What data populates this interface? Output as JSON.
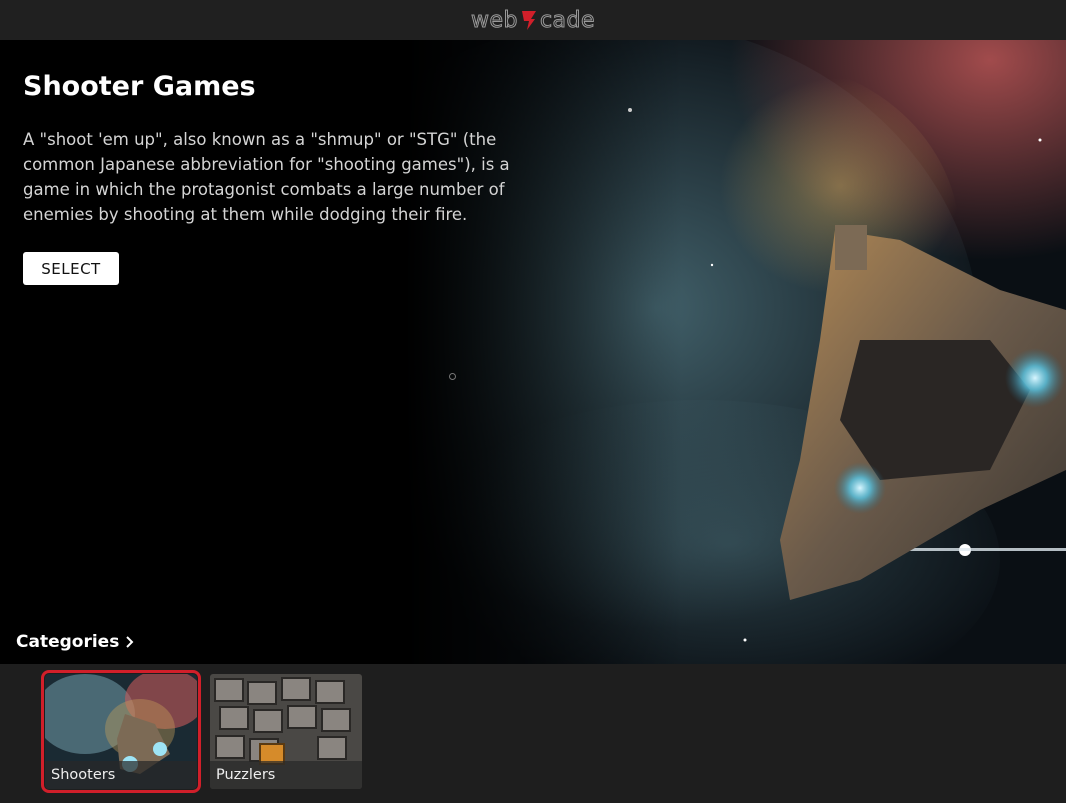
{
  "app": {
    "logo_text": "web cade"
  },
  "hero": {
    "title": "Shooter Games",
    "description": "A \"shoot 'em up\", also known as a \"shmup\" or \"STG\" (the common Japanese abbreviation for \"shooting games\"), is a game in which the protagonist combats a large number of enemies by shooting at them while dodging their fire.",
    "select_label": "SELECT"
  },
  "categories": {
    "header": "Categories",
    "items": [
      {
        "label": "Shooters",
        "selected": true
      },
      {
        "label": "Puzzlers",
        "selected": false
      }
    ]
  },
  "colors": {
    "selection": "#d11f2a",
    "background": "#1c1c1c"
  }
}
